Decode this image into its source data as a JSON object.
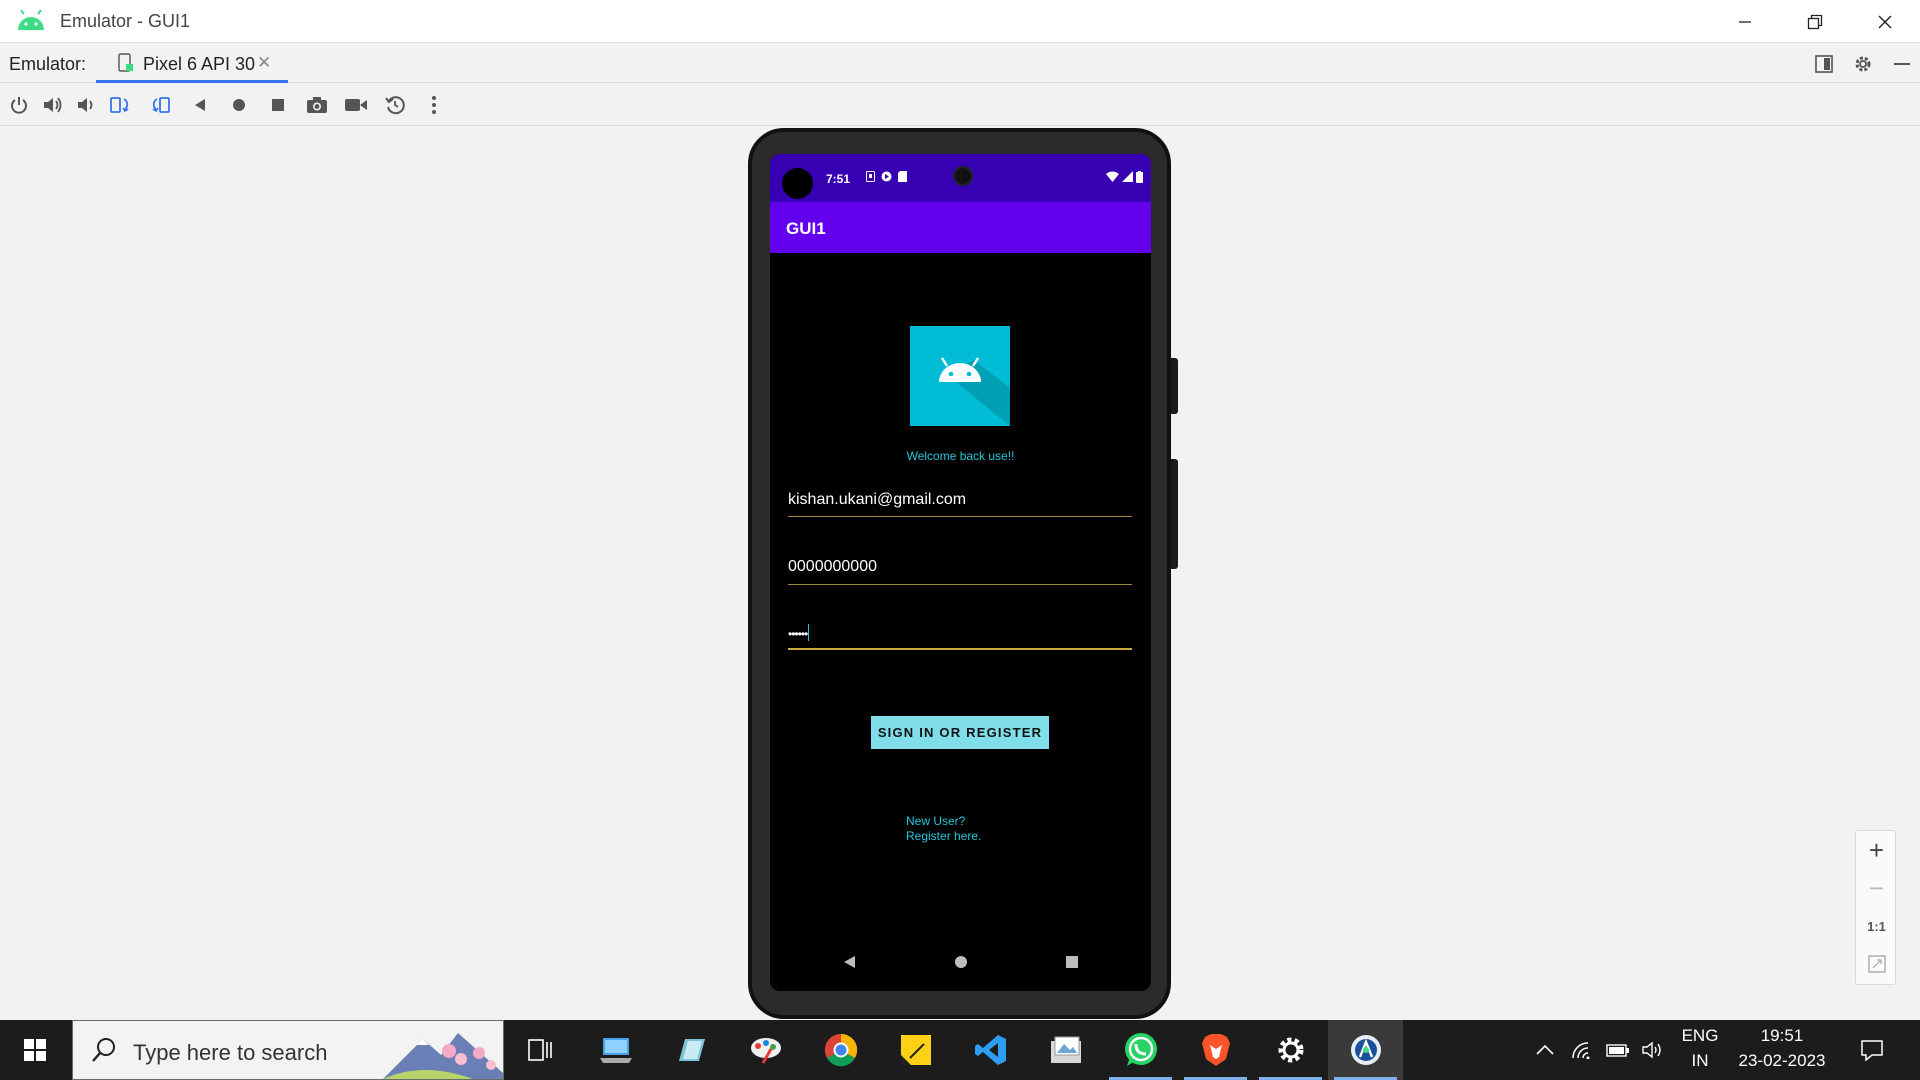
{
  "window": {
    "title": "Emulator - GUI1"
  },
  "tabbar": {
    "label": "Emulator:",
    "tab_name": "Pixel 6 API 30",
    "tab_close": "✕"
  },
  "device": {
    "status_time": "7:51",
    "app_title": "GUI1",
    "welcome_text": "Welcome back use!!",
    "email_value": "kishan.ukani@gmail.com",
    "phone_value": "0000000000",
    "password_value": "••••••",
    "signin_label": "SIGN IN OR REGISTER",
    "new_user_line1": "New User?",
    "new_user_line2": "Register here."
  },
  "zoom": {
    "plus": "+",
    "minus": "−",
    "one_to_one": "1:1"
  },
  "taskbar": {
    "search_placeholder": "Type here to search",
    "lang_line1": "ENG",
    "lang_line2": "IN",
    "clock_time": "19:51",
    "clock_date": "23-02-2023"
  },
  "colors": {
    "status_bar": "#3700b3",
    "app_bar": "#6200ee",
    "logo_bg": "#00bcd4",
    "accent_text": "#26c6da",
    "button_bg": "#80deea",
    "field_underline": "#c9a93c",
    "tab_underline": "#3574f0"
  },
  "icons": {
    "toolbar": [
      "power-icon",
      "volume-up-icon",
      "volume-down-icon",
      "rotate-left-icon",
      "rotate-right-icon",
      "back-icon",
      "home-icon",
      "overview-icon",
      "camera-icon",
      "record-icon",
      "reset-icon",
      "more-icon"
    ],
    "taskbar": [
      "task-view-icon",
      "pc-icon",
      "pencil-app-icon",
      "paint-icon",
      "chrome-icon",
      "sticky-notes-icon",
      "vscode-icon",
      "photos-icon",
      "whatsapp-icon",
      "brave-icon",
      "settings-icon",
      "android-studio-icon"
    ]
  }
}
